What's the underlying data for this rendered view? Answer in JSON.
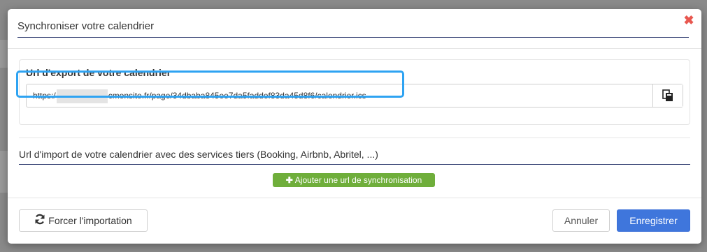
{
  "modal": {
    "title": "Synchroniser votre calendrier",
    "close_icon": "close-icon"
  },
  "export": {
    "label": "Url d'export de votre calendrier",
    "url_prefix": "https:/",
    "url_suffix": "cmonsite.fr/page/34dbaba845ee7da5faddef83da45d8f6/calendrier.ics",
    "copy_icon": "copy-icon"
  },
  "import": {
    "label": "Url d'import de votre calendrier avec des services tiers (Booking, Airbnb, Abritel, ...)",
    "add_button": "Ajouter une url de synchronisation"
  },
  "footer": {
    "force_import": "Forcer l'importation",
    "cancel": "Annuler",
    "save": "Enregistrer"
  },
  "colors": {
    "primary": "#3f76dc",
    "success": "#6fae3b",
    "danger": "#e8574f",
    "highlight": "#2ea3f2"
  }
}
